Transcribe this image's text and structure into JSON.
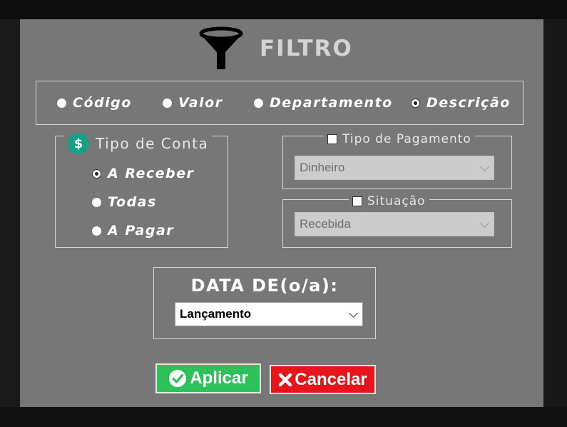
{
  "dialog": {
    "title": "FILTRO",
    "icon": "funnel-icon"
  },
  "search_by": {
    "options": [
      {
        "label": "Código",
        "checked": false
      },
      {
        "label": "Valor",
        "checked": false
      },
      {
        "label": "Departamento",
        "checked": false
      },
      {
        "label": "Descrição",
        "checked": true
      }
    ]
  },
  "tipo_conta": {
    "legend": "Tipo de Conta",
    "icon": "dollar-icon",
    "options": [
      {
        "label": "A Receber",
        "checked": true
      },
      {
        "label": "Todas",
        "checked": false
      },
      {
        "label": "A Pagar",
        "checked": false
      }
    ]
  },
  "tipo_pagamento": {
    "legend": "Tipo de Pagamento",
    "checked": false,
    "value": "Dinheiro"
  },
  "situacao": {
    "legend": "Situação",
    "checked": false,
    "value": "Recebida"
  },
  "data_de": {
    "label": "DATA DE(o/a):",
    "value": "Lançamento"
  },
  "buttons": {
    "apply": "Aplicar",
    "cancel": "Cancelar"
  },
  "colors": {
    "dialog_bg": "#777777",
    "apply": "#2ec15a",
    "cancel": "#e8141c",
    "accent_icon": "#16a085"
  }
}
